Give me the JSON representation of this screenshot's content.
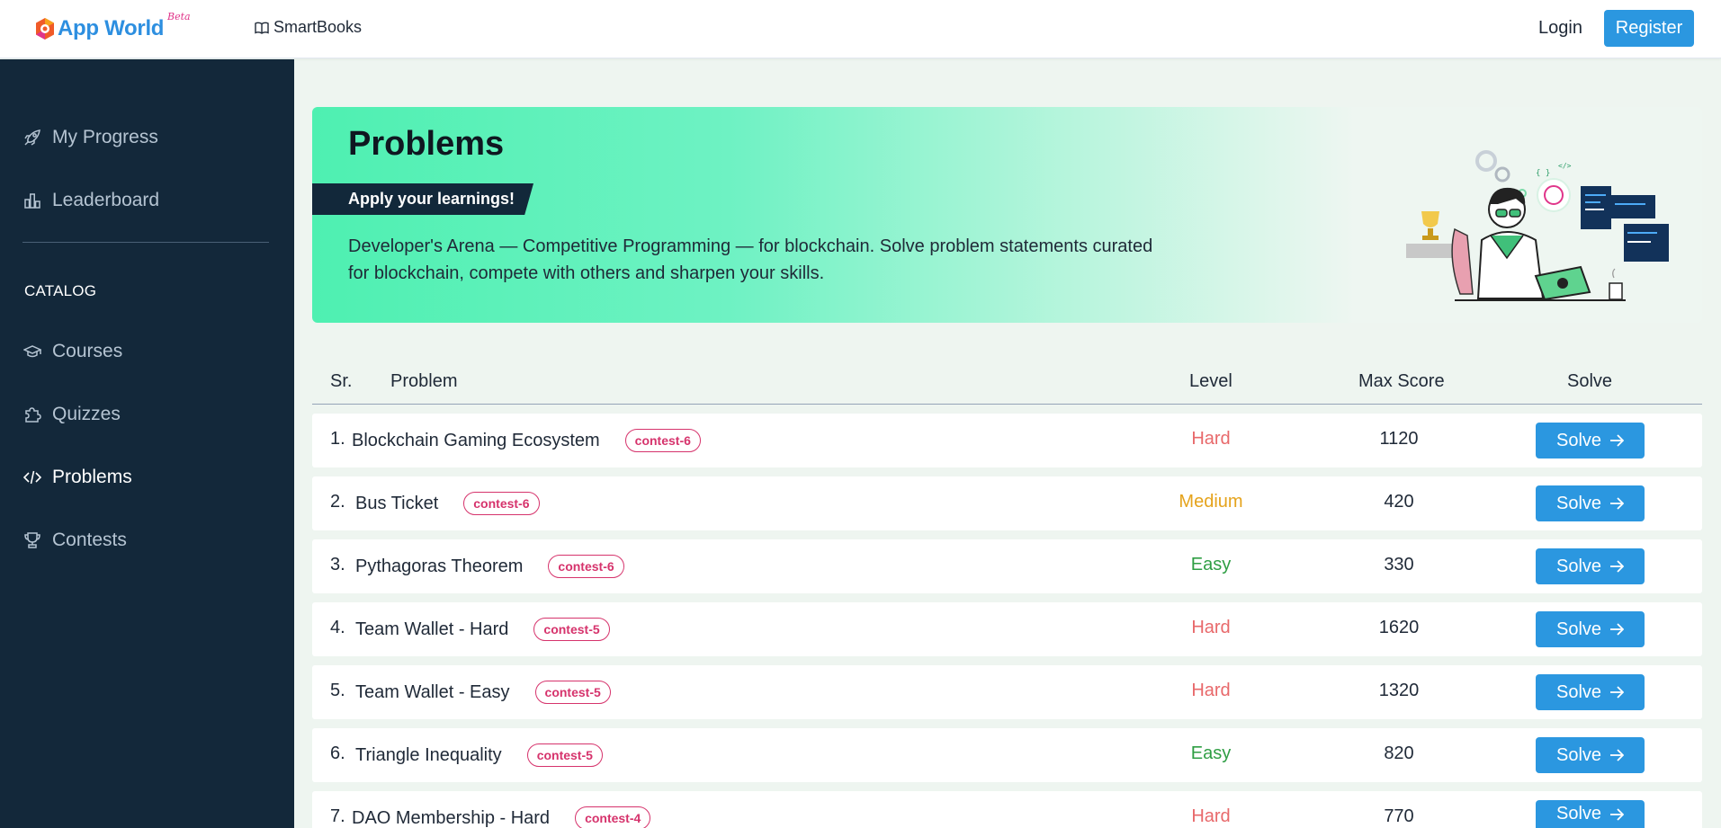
{
  "header": {
    "logo_text": "App World",
    "logo_badge": "Beta",
    "smartbooks_label": "SmartBooks",
    "login_label": "Login",
    "register_label": "Register"
  },
  "sidebar": {
    "items": [
      {
        "label": "My Progress",
        "icon": "rocket-icon"
      },
      {
        "label": "Leaderboard",
        "icon": "bar-chart-icon"
      }
    ],
    "section_title": "CATALOG",
    "catalog_items": [
      {
        "label": "Courses",
        "icon": "graduation-cap-icon"
      },
      {
        "label": "Quizzes",
        "icon": "puzzle-icon"
      },
      {
        "label": "Problems",
        "icon": "code-icon",
        "active": true
      },
      {
        "label": "Contests",
        "icon": "trophy-icon"
      }
    ]
  },
  "banner": {
    "title": "Problems",
    "tag": "Apply your learnings!",
    "description": "Developer's Arena — Competitive Programming — for blockchain. Solve problem statements curated for blockchain, compete with others and sharpen your skills."
  },
  "table": {
    "headers": {
      "sr": "Sr.",
      "problem": "Problem",
      "level": "Level",
      "max_score": "Max Score",
      "solve": "Solve"
    },
    "solve_label": "Solve",
    "rows": [
      {
        "num": "1.",
        "name": "Blockchain Gaming Ecosystem",
        "badge": "contest-6",
        "level": "Hard",
        "score": "1120"
      },
      {
        "num": "2.",
        "name": "Bus Ticket",
        "badge": "contest-6",
        "level": "Medium",
        "score": "420"
      },
      {
        "num": "3.",
        "name": "Pythagoras Theorem",
        "badge": "contest-6",
        "level": "Easy",
        "score": "330"
      },
      {
        "num": "4.",
        "name": "Team Wallet - Hard",
        "badge": "contest-5",
        "level": "Hard",
        "score": "1620"
      },
      {
        "num": "5.",
        "name": "Team Wallet - Easy",
        "badge": "contest-5",
        "level": "Hard",
        "score": "1320"
      },
      {
        "num": "6.",
        "name": "Triangle Inequality",
        "badge": "contest-5",
        "level": "Easy",
        "score": "820"
      },
      {
        "num": "7.",
        "name": "DAO Membership - Hard",
        "badge": "contest-4",
        "level": "Hard",
        "score": "770"
      }
    ]
  },
  "colors": {
    "accent": "#2b97e0",
    "sidebar_bg": "#13283a",
    "hard": "#e8696b",
    "medium": "#e5a31c",
    "easy": "#2f9e44",
    "badge": "#d6336c"
  }
}
